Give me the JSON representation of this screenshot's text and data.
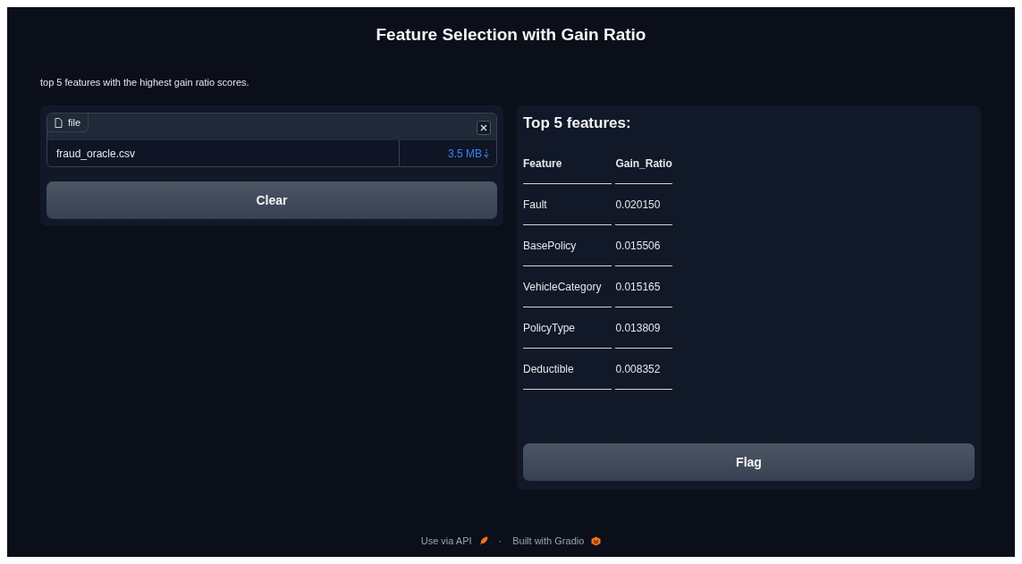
{
  "title": "Feature Selection with Gain Ratio",
  "description": "top 5 features with the highest gain ratio scores.",
  "file_input": {
    "label": "file",
    "file_name": "fraud_oracle.csv",
    "file_size": "3.5 MB"
  },
  "clear_button": "Clear",
  "output": {
    "heading": "Top 5 features:",
    "table": {
      "columns": [
        "Feature",
        "Gain_Ratio"
      ],
      "rows": [
        [
          "Fault",
          "0.020150"
        ],
        [
          "BasePolicy",
          "0.015506"
        ],
        [
          "VehicleCategory",
          "0.015165"
        ],
        [
          "PolicyType",
          "0.013809"
        ],
        [
          "Deductible",
          "0.008352"
        ]
      ]
    }
  },
  "flag_button": "Flag",
  "footer": {
    "api_link": "Use via API",
    "separator": "·",
    "built_with": "Built with Gradio"
  }
}
